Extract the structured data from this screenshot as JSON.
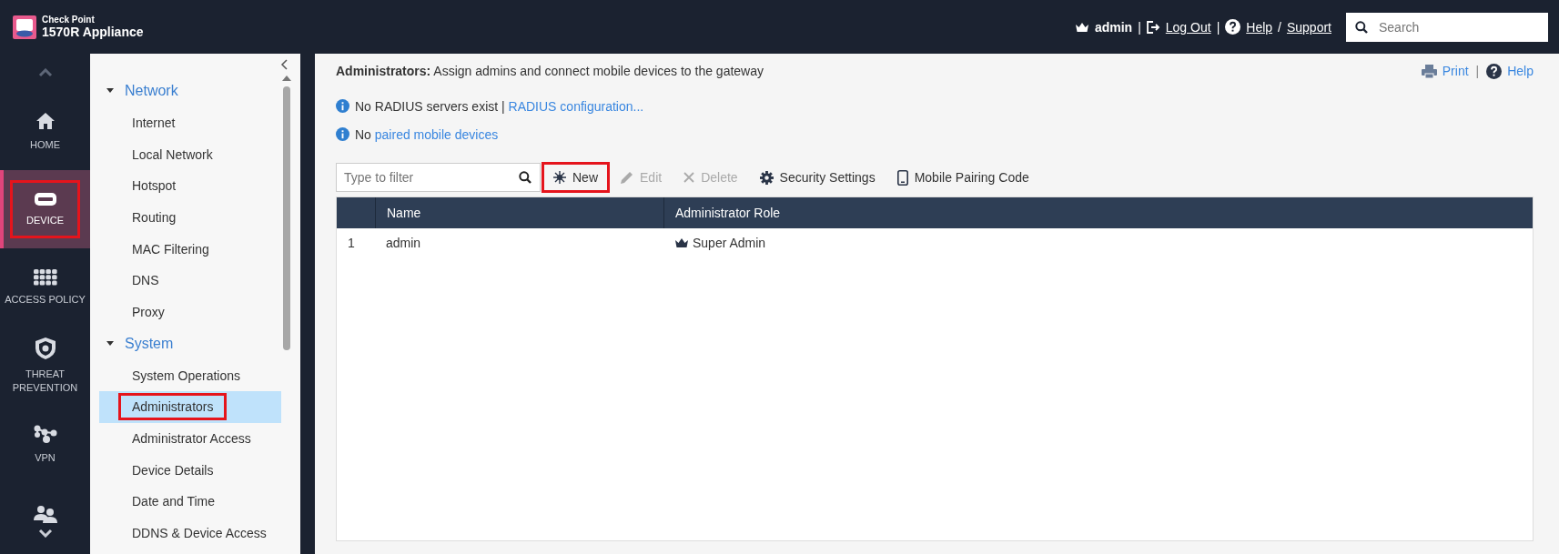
{
  "header": {
    "brand_small": "Check Point",
    "brand": "1570R Appliance",
    "items": [
      {
        "kind": "user",
        "text": "admin"
      },
      {
        "kind": "sep",
        "text": "|"
      },
      {
        "kind": "logout",
        "text": "Log Out"
      },
      {
        "kind": "sep",
        "text": "|"
      },
      {
        "kind": "help",
        "text": "Help"
      },
      {
        "kind": "sep",
        "text": "/"
      },
      {
        "kind": "link",
        "text": "Support"
      }
    ],
    "search": {
      "placeholder": "Search"
    }
  },
  "nav": [
    {
      "kind": "home",
      "label": "HOME",
      "selected": false,
      "highlighted": false
    },
    {
      "kind": "device",
      "label": "DEVICE",
      "selected": true,
      "highlighted": true
    },
    {
      "kind": "grid",
      "label": "ACCESS POLICY",
      "selected": false,
      "highlighted": false
    },
    {
      "kind": "shield",
      "label": "THREAT PREVENTION",
      "selected": false,
      "highlighted": false
    },
    {
      "kind": "vpn",
      "label": "VPN",
      "selected": false,
      "highlighted": false
    },
    {
      "kind": "users",
      "selected": false,
      "highlighted": false
    }
  ],
  "tree": [
    {
      "label": "Network",
      "expanded": true,
      "children": [
        {
          "label": "Internet",
          "selected": false,
          "highlighted": false
        },
        {
          "label": "Local Network",
          "selected": false,
          "highlighted": false
        },
        {
          "label": "Hotspot",
          "selected": false,
          "highlighted": false
        },
        {
          "label": "Routing",
          "selected": false,
          "highlighted": false
        },
        {
          "label": "MAC Filtering",
          "selected": false,
          "highlighted": false
        },
        {
          "label": "DNS",
          "selected": false,
          "highlighted": false
        },
        {
          "label": "Proxy",
          "selected": false,
          "highlighted": false
        }
      ]
    },
    {
      "label": "System",
      "expanded": true,
      "children": [
        {
          "label": "System Operations",
          "selected": false,
          "highlighted": false
        },
        {
          "label": "Administrators",
          "selected": true,
          "highlighted": true
        },
        {
          "label": "Administrator Access",
          "selected": false,
          "highlighted": false
        },
        {
          "label": "Device Details",
          "selected": false,
          "highlighted": false
        },
        {
          "label": "Date and Time",
          "selected": false,
          "highlighted": false
        },
        {
          "label": "DDNS & Device Access",
          "selected": false,
          "highlighted": false
        }
      ]
    }
  ],
  "page": {
    "title": "**Administrators:** Assign admins and connect mobile devices to the gateway",
    "links": [
      {
        "kind": "print",
        "text": "Print"
      },
      {
        "kind": "sep",
        "text": "|"
      },
      {
        "kind": "help",
        "text": "Help"
      }
    ],
    "notices": [
      {
        "text": "No RADIUS servers exist |",
        "link": "RADIUS configuration..."
      },
      {
        "text": "No",
        "link": "paired mobile devices"
      }
    ]
  },
  "toolbar": {
    "filter": {
      "placeholder": "Type to filter"
    },
    "buttons": [
      {
        "kind": "new",
        "label": "New",
        "disabled": false,
        "highlighted": true
      },
      {
        "kind": "edit",
        "label": "Edit",
        "disabled": true,
        "highlighted": false
      },
      {
        "kind": "delete",
        "label": "Delete",
        "disabled": true,
        "highlighted": false
      },
      {
        "kind": "settings",
        "label": "Security Settings",
        "disabled": false,
        "highlighted": false
      },
      {
        "kind": "mobile",
        "label": "Mobile Pairing Code",
        "disabled": false,
        "highlighted": false
      }
    ]
  },
  "table": {
    "columns": [
      "Name",
      "Administrator Role"
    ],
    "rows": [
      {
        "index": "1",
        "name": "admin",
        "role": "Super Admin"
      }
    ]
  }
}
